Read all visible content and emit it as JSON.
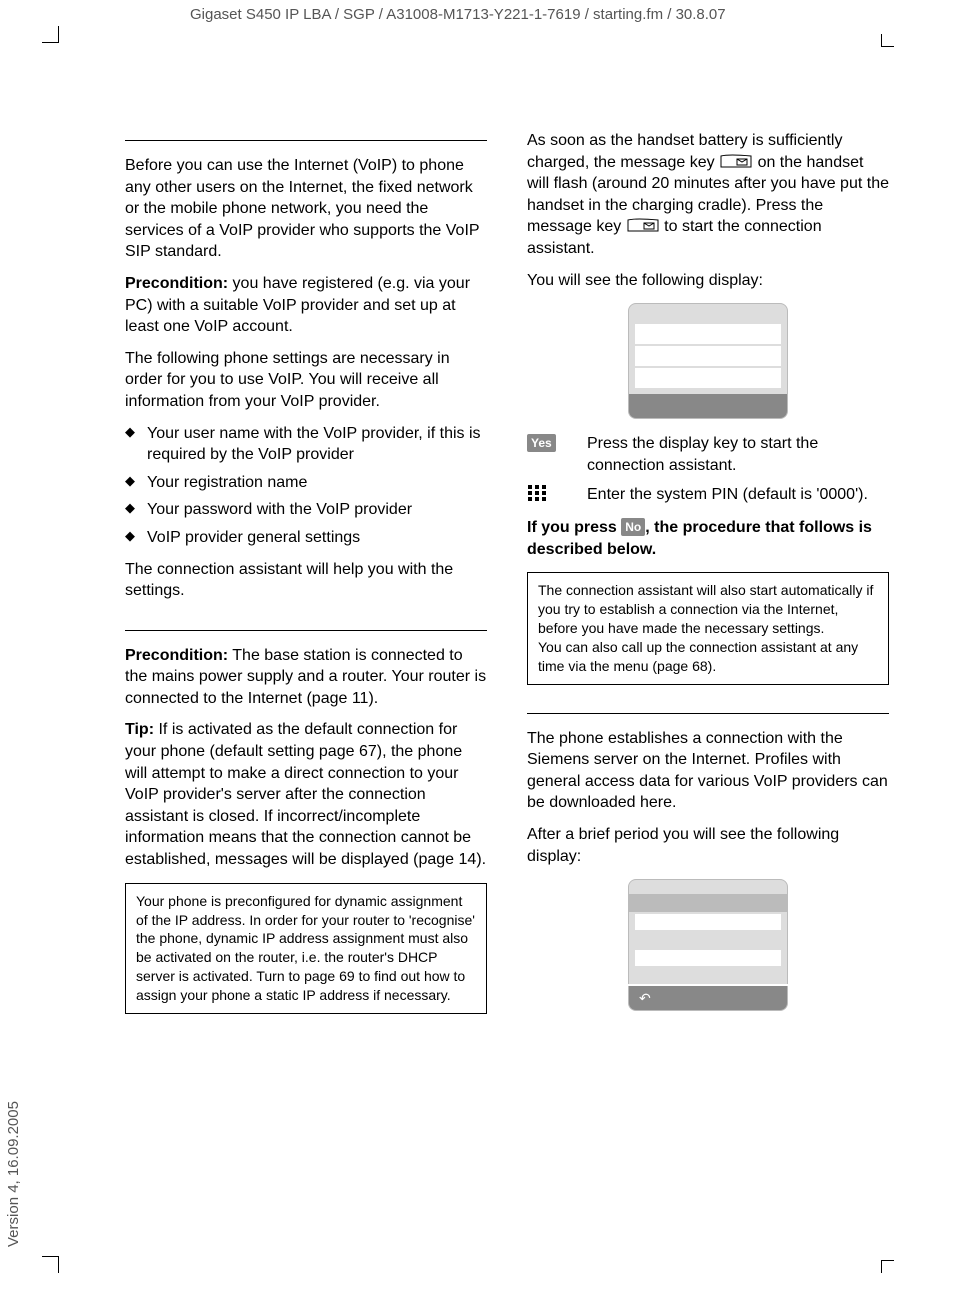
{
  "header": {
    "path": "Gigaset S450 IP LBA / SGP / A31008-M1713-Y221-1-7619 / starting.fm / 30.8.07"
  },
  "sidebar": {
    "version": "Version 4, 16.09.2005"
  },
  "left": {
    "p1": "Before you can use the Internet (VoIP) to phone any other users on the Internet, the fixed network or the mobile phone network, you need the services of a VoIP provider who supports the VoIP SIP standard.",
    "precond_label": "Precondition:",
    "precond_text": " you have registered (e.g. via your PC) with a suitable VoIP provider and set up at least one VoIP account.",
    "p3": "The following phone settings are necessary in order for you to use VoIP. You will receive all information from your VoIP provider.",
    "b1": "Your user name with the VoIP provider, if this is required by the VoIP provider",
    "b2": "Your registration name",
    "b3": "Your password with the VoIP provider",
    "b4": "VoIP provider general settings",
    "p4": "The connection assistant will help you with the settings.",
    "precond2_label": "Precondition:",
    "precond2_text": " The base station is connected to the mains power supply and a router. Your router is connected to the Internet (page 11).",
    "tip_label": "Tip:",
    "tip_text": " If        is activated as the default connection for your phone (default setting page 67), the phone will attempt to make a direct connection to your VoIP provider's server after the connection assistant is closed. If incorrect/incomplete information means that the connection cannot be established, messages will be displayed (page 14).",
    "note1": "Your phone is preconfigured for dynamic assignment of the IP address. In order for your router to 'recognise' the phone, dynamic IP address assignment must also be activated on the router, i.e. the router's DHCP server is activated. Turn to page 69 to find out how to assign your phone a static IP address if necessary."
  },
  "right": {
    "p1a": "As soon as the handset battery is sufficiently charged, the message key ",
    "p1b": " on the handset will flash (around 20 minutes after you have put the handset in the charging cradle). Press the message key ",
    "p1c": " to start the connection assistant.",
    "p2": "You will see the following display:",
    "yes_label": "Yes",
    "yes_text": "Press the display key to start the connection assistant.",
    "pin_text": "Enter the system PIN (default is '0000').",
    "ifpress_a": "If you press ",
    "no_label": "No",
    "ifpress_b": ", the procedure that follows is described below.",
    "note2a": "The connection assistant will also start automatically if you try to establish a connection via the Internet, before you have made the necessary settings.",
    "note2b": "You can also call up the connection assistant at any time via the menu (page 68).",
    "p3": "The phone establishes a connection with the Siemens server on the Internet. Profiles with general access data for various VoIP providers can be downloaded here.",
    "p4": "After a brief period you will see the following display:"
  }
}
